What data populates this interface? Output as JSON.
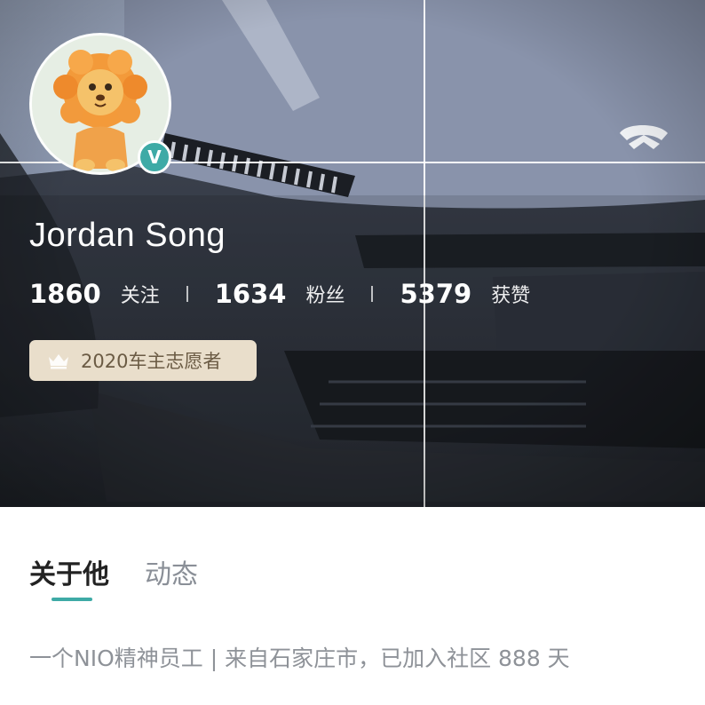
{
  "profile": {
    "name": "Jordan Song",
    "avatar_icon": "lion-cartoon-avatar",
    "verified_icon": "verified-v-icon",
    "verified_mark": "V",
    "stats": [
      {
        "value": "1860",
        "label": "关注"
      },
      {
        "value": "1634",
        "label": "粉丝"
      },
      {
        "value": "5379",
        "label": "获赞"
      }
    ],
    "badge": {
      "icon": "crown-icon",
      "text": "2020车主志愿者"
    }
  },
  "tabs": [
    {
      "label": "关于他",
      "active": true
    },
    {
      "label": "动态",
      "active": false
    }
  ],
  "bio": "一个NIO精神员工 | 来自石家庄市，已加入社区 888 天",
  "colors": {
    "accent": "#3eaaa6",
    "badge_bg": "#e9decb",
    "badge_text": "#6b5b44",
    "muted_text": "#8e9298"
  }
}
